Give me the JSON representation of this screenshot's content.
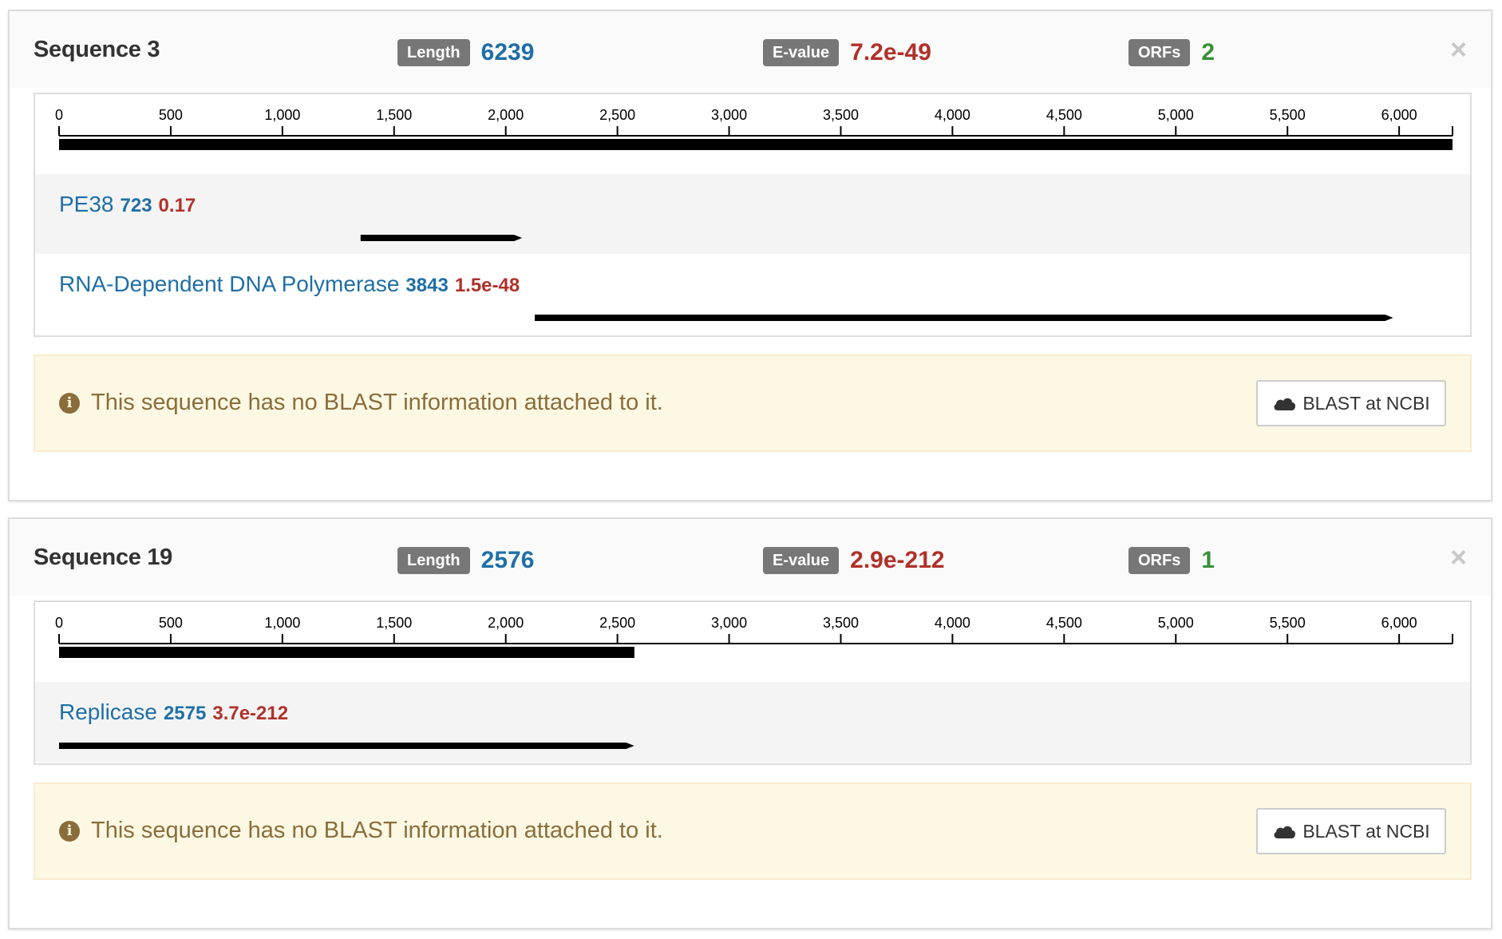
{
  "axis": {
    "max": 6239,
    "ticks": [
      0,
      500,
      1000,
      1500,
      2000,
      2500,
      3000,
      3500,
      4000,
      4500,
      5000,
      5500,
      6000
    ],
    "tick_labels": [
      "0",
      "500",
      "1,000",
      "1,500",
      "2,000",
      "2,500",
      "3,000",
      "3,500",
      "4,000",
      "4,500",
      "5,000",
      "5,500",
      "6,000"
    ]
  },
  "badges": {
    "length": "Length",
    "evalue": "E-value",
    "orfs": "ORFs"
  },
  "close_glyph": "×",
  "alert": {
    "text": "This sequence has no BLAST information attached to it.",
    "icon": "info-icon"
  },
  "blast_button": {
    "label": "BLAST at NCBI",
    "icon": "cloud-icon"
  },
  "colors": {
    "value_blue": "#1f6fa6",
    "value_red": "#b0312a",
    "value_green": "#3a8f3a",
    "badge": "#777777",
    "alert_bg": "#fcf8e3"
  },
  "sequences": [
    {
      "title": "Sequence 3",
      "length": "6239",
      "evalue": "7.2e-49",
      "orfs": "2",
      "sequence_length": 6239,
      "orf_list": [
        {
          "name": "PE38",
          "length": "723",
          "evalue": "0.17",
          "start": 1350,
          "end": 2073
        },
        {
          "name": "RNA-Dependent DNA Polymerase",
          "length": "3843",
          "evalue": "1.5e-48",
          "start": 2130,
          "end": 5973
        }
      ]
    },
    {
      "title": "Sequence 19",
      "length": "2576",
      "evalue": "2.9e-212",
      "orfs": "1",
      "sequence_length": 2576,
      "orf_list": [
        {
          "name": "Replicase",
          "length": "2575",
          "evalue": "3.7e-212",
          "start": 0,
          "end": 2575
        }
      ]
    }
  ]
}
